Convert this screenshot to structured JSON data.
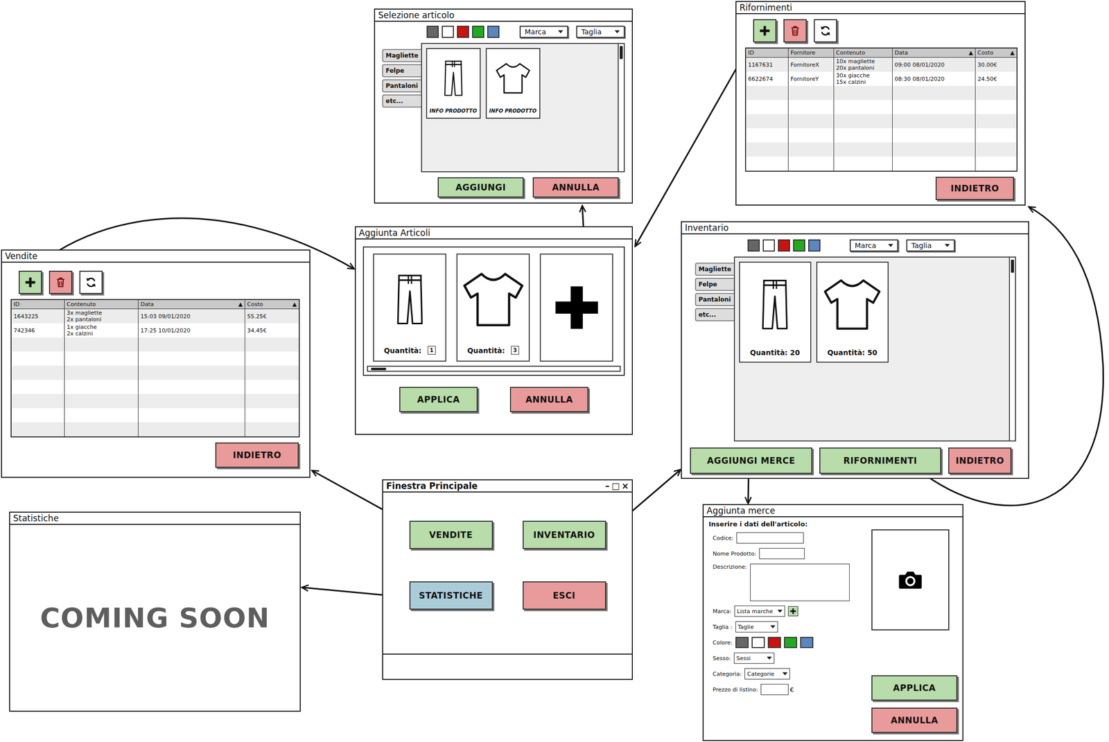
{
  "selezione_articolo": {
    "title": "Selezione articolo",
    "colors": [
      "#666666",
      "#ffffff",
      "#cc1111",
      "#22aa22",
      "#5b86c0"
    ],
    "filters": [
      "Marca",
      "Taglia"
    ],
    "categories": [
      "Magliette",
      "Felpe",
      "Pantaloni",
      "etc..."
    ],
    "products": [
      {
        "kind": "pants",
        "label": "INFO PRODOTTO"
      },
      {
        "kind": "shirt",
        "label": "INFO PRODOTTO"
      }
    ],
    "buttons": [
      {
        "label": "AGGIUNGI",
        "color": "#b8dcaa"
      },
      {
        "label": "ANNULLA",
        "color": "#e99a9a"
      }
    ]
  },
  "rifornimenti": {
    "title": "Rifornimenti",
    "toolbar": [
      {
        "kind": "add",
        "color": "#b8dcaa"
      },
      {
        "kind": "delete",
        "color": "#e99a9a"
      },
      {
        "kind": "refresh",
        "color": "#ffffff"
      }
    ],
    "columns": [
      {
        "label": "ID"
      },
      {
        "label": "Fornitore"
      },
      {
        "label": "Contenuto"
      },
      {
        "label": "Data",
        "sort_icon": "▲"
      },
      {
        "label": "Costo",
        "sort_icon": "▲"
      }
    ],
    "rows": [
      [
        "1167631",
        "FornitoreX",
        [
          "10x magliette",
          "20x pantaloni"
        ],
        "09:00 08/01/2020",
        "30.00€"
      ],
      [
        "6622674",
        "FornitoreY",
        [
          "30x giacche",
          "15x calzini"
        ],
        "08:30 08/01/2020",
        "24.50€"
      ]
    ],
    "back_button": {
      "label": "INDIETRO",
      "color": "#e99a9a"
    }
  },
  "aggiunta_articoli": {
    "title": "Aggiunta Articoli",
    "items": [
      {
        "kind": "pants",
        "quantity_label": "Quantità:",
        "quantity": "1"
      },
      {
        "kind": "shirt",
        "quantity_label": "Quantità:",
        "quantity": "3"
      },
      {
        "kind": "add"
      }
    ],
    "buttons": [
      {
        "label": "APPLICA",
        "color": "#b8dcaa"
      },
      {
        "label": "ANNULLA",
        "color": "#e99a9a"
      }
    ]
  },
  "vendite": {
    "title": "Vendite",
    "toolbar": [
      {
        "kind": "add",
        "color": "#b8dcaa"
      },
      {
        "kind": "delete",
        "color": "#e99a9a"
      },
      {
        "kind": "refresh",
        "color": "#ffffff"
      }
    ],
    "columns": [
      {
        "label": "ID"
      },
      {
        "label": "Contenuto"
      },
      {
        "label": "Data",
        "sort_icon": "▲"
      },
      {
        "label": "Costo",
        "sort_icon": "▲"
      }
    ],
    "rows": [
      [
        "1643225",
        [
          "3x magliette",
          "2x pantaloni"
        ],
        "15:03 09/01/2020",
        "55.25€"
      ],
      [
        "742346",
        [
          "1x giacche",
          "2x calzini"
        ],
        "17:25 10/01/2020",
        "34.45€"
      ]
    ],
    "back_button": {
      "label": "INDIETRO",
      "color": "#e99a9a"
    }
  },
  "inventario": {
    "title": "Inventario",
    "colors": [
      "#666666",
      "#ffffff",
      "#cc1111",
      "#22aa22",
      "#5b86c0"
    ],
    "filters": [
      "Marca",
      "Taglia"
    ],
    "categories": [
      "Magliette",
      "Felpe",
      "Pantaloni",
      "etc..."
    ],
    "products": [
      {
        "kind": "pants",
        "label": "Quantità: 20"
      },
      {
        "kind": "shirt",
        "label": "Quantità: 50"
      }
    ],
    "buttons": [
      {
        "label": "AGGIUNGI MERCE",
        "color": "#b8dcaa"
      },
      {
        "label": "RIFORNIMENTI",
        "color": "#b8dcaa"
      },
      {
        "label": "INDIETRO",
        "color": "#e99a9a"
      }
    ]
  },
  "finestra_principale": {
    "title": "Finestra Principale",
    "controls": [
      "–",
      "□",
      "×"
    ],
    "buttons": [
      {
        "label": "VENDITE",
        "color": "#b8dcaa"
      },
      {
        "label": "INVENTARIO",
        "color": "#b8dcaa"
      },
      {
        "label": "STATISTICHE",
        "color": "#a9ccd8"
      },
      {
        "label": "ESCI",
        "color": "#e99a9a"
      }
    ]
  },
  "statistiche": {
    "title": "Statistiche",
    "message": "COMING SOON"
  },
  "aggiunta_merce": {
    "title": "Aggiunta merce",
    "heading": "Inserire i dati dell'articolo:",
    "fields": [
      {
        "kind": "text",
        "label": "Codice:"
      },
      {
        "kind": "text",
        "label": "Nome Prodotto:"
      },
      {
        "kind": "textarea",
        "label": "Descrizione:"
      },
      {
        "kind": "select_add",
        "label": "Marca:",
        "value": "Lista marche"
      },
      {
        "kind": "select",
        "label": "Taglia :",
        "value": "Taglie"
      },
      {
        "kind": "colors",
        "label": "Colore:",
        "colors": [
          "#666666",
          "#ffffff",
          "#cc1111",
          "#22aa22",
          "#5b86c0"
        ]
      },
      {
        "kind": "select",
        "label": "Sesso:",
        "value": "Sessi"
      },
      {
        "kind": "select",
        "label": "Categoria:",
        "value": "Categorie"
      },
      {
        "kind": "price",
        "label": "Prezzo di listino:",
        "unit": "€"
      }
    ],
    "buttons": [
      {
        "label": "APPLICA",
        "color": "#b8dcaa"
      },
      {
        "label": "ANNULLA",
        "color": "#e99a9a"
      }
    ]
  }
}
